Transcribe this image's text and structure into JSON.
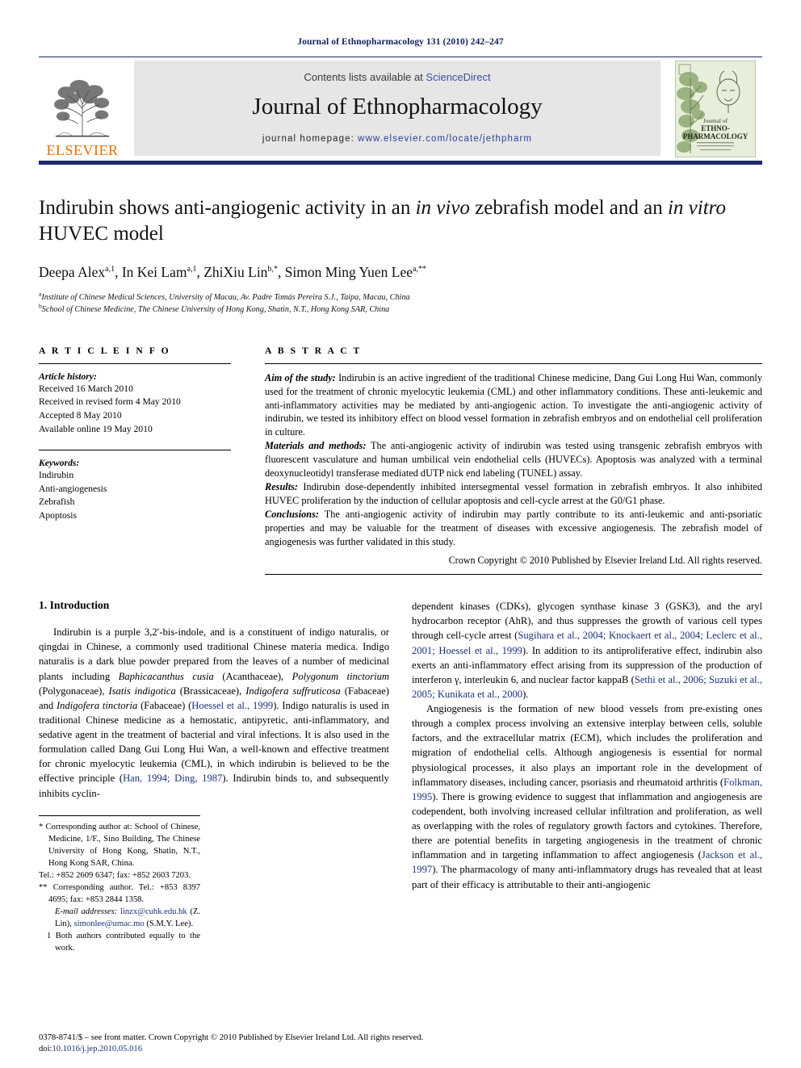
{
  "running_head": "Journal of Ethnopharmacology 131 (2010) 242–247",
  "masthead": {
    "publisher_name": "ELSEVIER",
    "contents_prefix": "Contents lists available at ",
    "contents_link": "ScienceDirect",
    "journal_title": "Journal of Ethnopharmacology",
    "homepage_prefix": "journal homepage: ",
    "homepage_url": "www.elsevier.com/locate/jethpharm",
    "cover_line1": "Journal of",
    "cover_line2": "ETHNO-",
    "cover_line3": "PHARMACOLOGY",
    "accent_blue": "#1b2a6b",
    "accent_orange": "#ee6e00",
    "link_blue": "#3a4fa0",
    "band_gray": "#e6e6e6"
  },
  "article": {
    "title_part1": "Indirubin shows anti-angiogenic activity in an ",
    "title_italic1": "in vivo",
    "title_part2": " zebrafish model and an ",
    "title_italic2": "in vitro",
    "title_part3": " HUVEC model",
    "authors": [
      {
        "name": "Deepa Alex",
        "sup": "a,1",
        "sep": ", "
      },
      {
        "name": "In Kei Lam",
        "sup": "a,1",
        "sep": ", "
      },
      {
        "name": "ZhiXiu Lin",
        "sup": "b,*",
        "sep": ", "
      },
      {
        "name": "Simon Ming Yuen Lee",
        "sup": "a,**",
        "sep": ""
      }
    ],
    "affiliations": [
      {
        "mark": "a",
        "text": "Institute of Chinese Medical Sciences, University of Macau, Av. Padre Tomás Pereira S.J., Taipa, Macau, China"
      },
      {
        "mark": "b",
        "text": "School of Chinese Medicine, The Chinese University of Hong Kong, Shatin, N.T., Hong Kong SAR, China"
      }
    ]
  },
  "article_info": {
    "heading": "A R T I C L E   I N F O",
    "history_label": "Article history:",
    "history": [
      "Received 16 March 2010",
      "Received in revised form 4 May 2010",
      "Accepted 8 May 2010",
      "Available online 19 May 2010"
    ],
    "keywords_label": "Keywords:",
    "keywords": [
      "Indirubin",
      "Anti-angiogenesis",
      "Zebrafish",
      "Apoptosis"
    ]
  },
  "abstract": {
    "heading": "A B S T R A C T",
    "sections": [
      {
        "lead": "Aim of the study:",
        "text": " Indirubin is an active ingredient of the traditional Chinese medicine, Dang Gui Long Hui Wan, commonly used for the treatment of chronic myelocytic leukemia (CML) and other inflammatory conditions. These anti-leukemic and anti-inflammatory activities may be mediated by anti-angiogenic action. To investigate the anti-angiogenic activity of indirubin, we tested its inhibitory effect on blood vessel formation in zebrafish embryos and on endothelial cell proliferation in culture."
      },
      {
        "lead": "Materials and methods:",
        "text": " The anti-angiogenic activity of indirubin was tested using transgenic zebrafish embryos with fluorescent vasculature and human umbilical vein endothelial cells (HUVECs). Apoptosis was analyzed with a terminal deoxynucleotidyl transferase mediated dUTP nick end labeling (TUNEL) assay."
      },
      {
        "lead": "Results:",
        "text": " Indirubin dose-dependently inhibited intersegmental vessel formation in zebrafish embryos. It also inhibited HUVEC proliferation by the induction of cellular apoptosis and cell-cycle arrest at the G0/G1 phase."
      },
      {
        "lead": "Conclusions:",
        "text": " The anti-angiogenic activity of indirubin may partly contribute to its anti-leukemic and anti-psoriatic properties and may be valuable for the treatment of diseases with excessive angiogenesis. The zebrafish model of angiogenesis was further validated in this study."
      }
    ],
    "copyright": "Crown Copyright © 2010 Published by Elsevier Ireland Ltd. All rights reserved."
  },
  "introduction": {
    "heading": "1.  Introduction",
    "left_paragraphs": [
      {
        "indent": true,
        "runs": [
          {
            "t": "Indirubin is a purple 3,2′-bis-indole, and is a constituent of indigo naturalis, or qingdai in Chinese, a commonly used traditional Chinese materia medica. Indigo naturalis is a dark blue powder prepared from the leaves of a number of medicinal plants including "
          },
          {
            "t": "Baphicacanthus cusia",
            "s": "ital"
          },
          {
            "t": " (Acanthaceae), "
          },
          {
            "t": "Polygonum tinctorium",
            "s": "ital"
          },
          {
            "t": " (Polygonaceae), "
          },
          {
            "t": "Isatis indigotica",
            "s": "ital"
          },
          {
            "t": " (Brassicaceae), "
          },
          {
            "t": "Indigofera suffruticosa",
            "s": "ital"
          },
          {
            "t": " (Fabaceae) and "
          },
          {
            "t": "Indigofera tinctoria",
            "s": "ital"
          },
          {
            "t": " (Fabaceae) ("
          },
          {
            "t": "Hoessel et al., 1999",
            "s": "ref"
          },
          {
            "t": "). Indigo naturalis is used in traditional Chinese medicine as a hemostatic, antipyretic, anti-inflammatory, and sedative agent in the treatment of bacterial and viral infections. It is also used in the formulation called Dang Gui Long Hui Wan, a well-known and effective treatment for chronic myelocytic leukemia (CML), in which indirubin is believed to be the effective principle ("
          },
          {
            "t": "Han, 1994; Ding, 1987",
            "s": "ref"
          },
          {
            "t": "). Indirubin binds to, and subsequently inhibits cyclin-"
          }
        ]
      }
    ],
    "right_paragraphs": [
      {
        "indent": false,
        "runs": [
          {
            "t": "dependent kinases (CDKs), glycogen synthase kinase 3 (GSK3), and the aryl hydrocarbon receptor (AhR), and thus suppresses the growth of various cell types through cell-cycle arrest ("
          },
          {
            "t": "Sugihara et al., 2004; Knockaert et al., 2004; Leclerc et al., 2001; Hoessel et al., 1999",
            "s": "ref"
          },
          {
            "t": "). In addition to its antiproliferative effect, indirubin also exerts an anti-inflammatory effect arising from its suppression of the production of interferon γ, interleukin 6, and nuclear factor kappaB ("
          },
          {
            "t": "Sethi et al., 2006; Suzuki et al., 2005; Kunikata et al., 2000",
            "s": "ref"
          },
          {
            "t": ")."
          }
        ]
      },
      {
        "indent": true,
        "runs": [
          {
            "t": "Angiogenesis is the formation of new blood vessels from pre-existing ones through a complex process involving an extensive interplay between cells, soluble factors, and the extracellular matrix (ECM), which includes the proliferation and migration of endothelial cells. Although angiogenesis is essential for normal physiological processes, it also plays an important role in the development of inflammatory diseases, including cancer, psoriasis and rheumatoid arthritis ("
          },
          {
            "t": "Folkman, 1995",
            "s": "ref"
          },
          {
            "t": "). There is growing evidence to suggest that inflammation and angiogenesis are codependent, both involving increased cellular infiltration and proliferation, as well as overlapping with the roles of regulatory growth factors and cytokines. Therefore, there are potential benefits in targeting angiogenesis in the treatment of chronic inflammation and in targeting inflammation to affect angiogenesis ("
          },
          {
            "t": "Jackson et al., 1997",
            "s": "ref"
          },
          {
            "t": "). The pharmacology of many anti-inflammatory drugs has revealed that at least part of their efficacy is attributable to their anti-angiogenic"
          }
        ]
      }
    ]
  },
  "footnotes": [
    {
      "mark": "*",
      "text": " Corresponding author at: School of Chinese, Medicine, 1/F., Sino Building, The Chinese University of Hong Kong, Shatin, N.T., Hong Kong SAR, China."
    },
    {
      "mark": "",
      "text": "Tel.: +852 2609 6347; fax: +852 2603 7203."
    },
    {
      "mark": "**",
      "text": " Corresponding author. Tel.: +853 8397 4695; fax: +853 2844 1358."
    },
    {
      "mark": "",
      "text": "E-mail addresses:",
      "emails": [
        {
          "addr": "linzx@cuhk.edu.hk",
          "who": " (Z. Lin), "
        },
        {
          "addr": "simonlee@umac.mo",
          "who": " (S.M.Y. Lee)."
        }
      ]
    },
    {
      "mark": "1",
      "text": " Both authors contributed equally to the work."
    }
  ],
  "footer": {
    "issn_line": "0378-8741/$ – see front matter. Crown Copyright © 2010 Published by Elsevier Ireland Ltd. All rights reserved.",
    "doi_prefix": "doi:",
    "doi_value": "10.1016/j.jep.2010.05.016"
  }
}
